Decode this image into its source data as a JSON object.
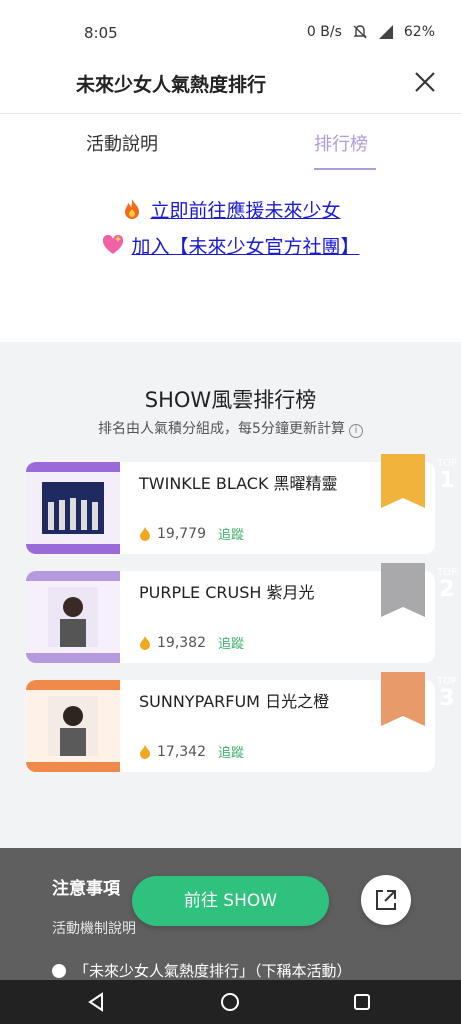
{
  "status_bar": {
    "time": "8:05",
    "network": "0 B/s",
    "battery": "62%"
  },
  "header": {
    "title": "未來少女人氣熱度排行"
  },
  "tabs": [
    {
      "label": "活動說明"
    },
    {
      "label": "排行榜"
    }
  ],
  "links": [
    {
      "emoji": "fire-emoji",
      "text": "立即前往應援未來少女"
    },
    {
      "emoji": "sparkling-heart-emoji",
      "text": "加入【未來少女官方社團】"
    }
  ],
  "ranking": {
    "title": "SHOW風雲排行榜",
    "subtitle": "排名由人氣積分組成，每5分鐘更新計算",
    "info_icon": "i",
    "items": [
      {
        "name": "TWINKLE BLACK 黑曜精靈",
        "score": "19,779",
        "follow": "追蹤",
        "badge_label": "TOP",
        "rank": "1",
        "badge_color": "#f0b43c",
        "thumb_color": "#9a6ad8"
      },
      {
        "name": "PURPLE CRUSH 紫月光",
        "score": "19,382",
        "follow": "追蹤",
        "badge_label": "TOP",
        "rank": "2",
        "badge_color": "#a9a9ab",
        "thumb_color": "#b69ae0"
      },
      {
        "name": "SUNNYPARFUM 日光之橙",
        "score": "17,342",
        "follow": "追蹤",
        "badge_label": "TOP",
        "rank": "3",
        "badge_color": "#e89a6a",
        "thumb_color": "#f08a4a"
      }
    ]
  },
  "notice": {
    "title": "注意事項",
    "subtitle": "活動機制說明",
    "bullet": "「未來少女人氣熱度排行」（下稱本活動）"
  },
  "cta": {
    "label": "前往 SHOW"
  },
  "colors": {
    "accent": "#2ec27e",
    "tab_active": "#b09be0",
    "link": "#1a1ad6"
  }
}
